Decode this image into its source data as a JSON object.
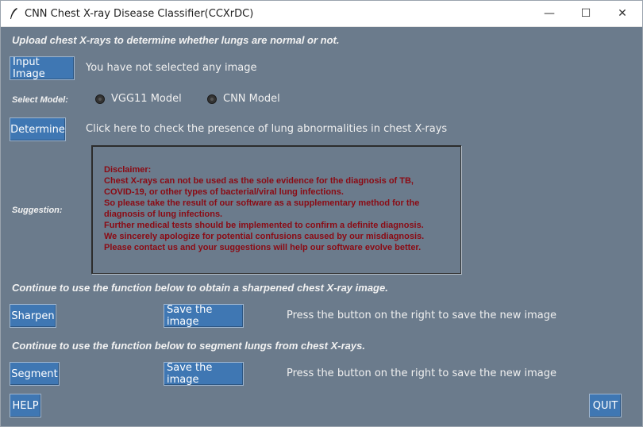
{
  "window": {
    "title": "CNN Chest X-ray Disease Classifier(CCXrDC)",
    "controls": {
      "minimize": "—",
      "maximize": "☐",
      "close": "✕"
    }
  },
  "upload_prompt": "Upload chest X-rays to determine whether lungs are normal or not.",
  "input_image": {
    "button_label": "Input Image",
    "status": "You have not selected any image"
  },
  "model_select": {
    "label": "Select Model:",
    "options": [
      "VGG11 Model",
      "CNN Model"
    ]
  },
  "determine": {
    "button_label": "Determine",
    "hint": "Click here to check the presence of lung abnormalities in chest X-rays"
  },
  "suggestion": {
    "label": "Suggestion:",
    "text": "Disclaimer:\nChest X-rays can not be used as the sole evidence for the diagnosis of TB,\nCOVID-19, or other types of bacterial/viral lung infections.\nSo please take the result of our software as a supplementary method for the\ndiagnosis of lung infections.\nFurther medical tests should be implemented to confirm a definite diagnosis.\nWe sincerely apologize for potential confusions caused by our misdiagnosis.\nPlease contact us and your suggestions will help our software evolve better."
  },
  "sharpen_section": {
    "heading": "Continue to use the function below to obtain a sharpened chest X-ray image.",
    "action_label": "Sharpen",
    "save_label": "Save the image",
    "hint": "Press the button on the right to save the new image"
  },
  "segment_section": {
    "heading": "Continue to use the function below to segment lungs from chest X-rays.",
    "action_label": "Segment",
    "save_label": "Save the image",
    "hint": "Press the button on the right to save the new image"
  },
  "help_label": "HELP",
  "quit_label": "QUIT",
  "colors": {
    "background": "#6b7b8c",
    "button": "#3f77b3",
    "disclaimer_text": "#8b0a13"
  }
}
